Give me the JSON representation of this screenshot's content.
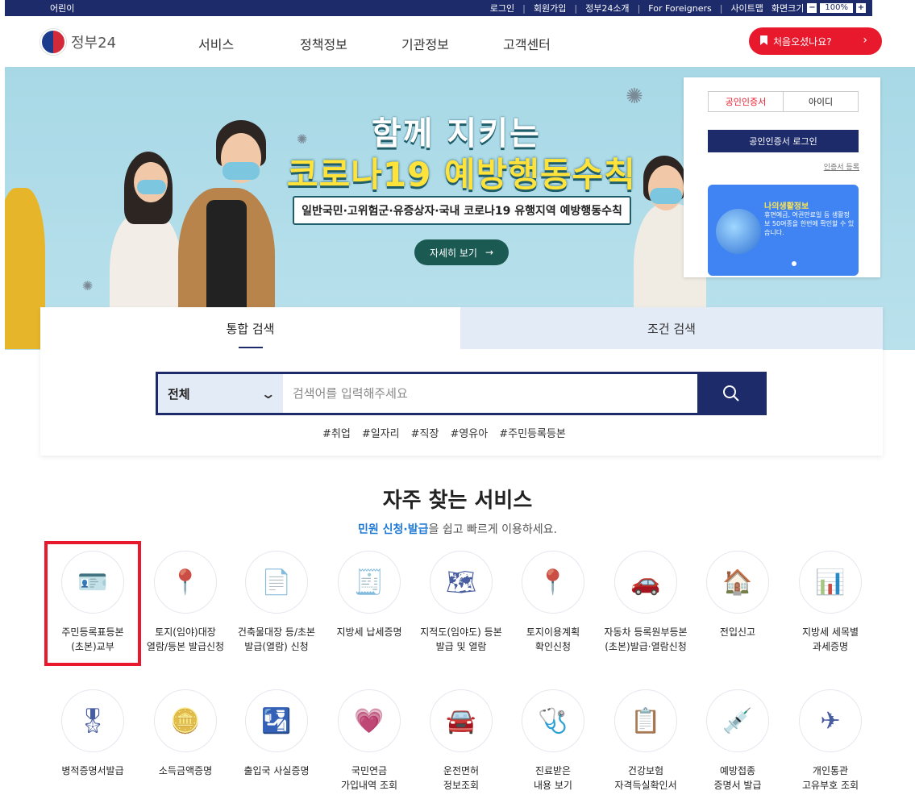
{
  "util": {
    "left": "어린이",
    "links": [
      "로그인",
      "회원가입",
      "정부24소개",
      "For Foreigners",
      "사이트맵"
    ],
    "zoom_label": "화면크기",
    "zoom_value": "100%"
  },
  "header": {
    "logo_text": "정부24",
    "menu": [
      "서비스",
      "정책정보",
      "기관정보",
      "고객센터"
    ],
    "cta": "처음오셨나요?"
  },
  "hero": {
    "title_line1": "함께 지키는",
    "title_line2": "코로나19 예방행동수칙",
    "subtitle": "일반국민·고위험군·유증상자·국내 코로나19 유행지역 예방행동수칙",
    "button": "자세히 보기",
    "colors": {
      "sky": "#b9e1ec",
      "title_fill": "#ffffff",
      "title_yellow": "#ffe33b",
      "button_bg": "#1b5a52"
    }
  },
  "login": {
    "tabs": [
      "공인인증서",
      "아이디"
    ],
    "button": "공인인증서 로그인",
    "register": "인증서 등록",
    "card_title": "나의생활정보",
    "card_desc": "휴면예금, 여권만료일 등 생활정보 50여종을 한번에 확인할 수 있습니다."
  },
  "search": {
    "tabs": [
      "통합 검색",
      "조건 검색"
    ],
    "category": "전체",
    "placeholder": "검색어를 입력해주세요",
    "hashtags": [
      "#취업",
      "#일자리",
      "#직장",
      "#영유아",
      "#주민등록등본"
    ]
  },
  "frequent": {
    "title": "자주 찾는 서비스",
    "sub_highlight": "민원 신청·발급",
    "sub_rest": "을 쉽고 빠르게 이용하세요.",
    "row1": [
      {
        "icon": "resident-card-icon",
        "label1": "주민등록표등본",
        "label2": "(초본)교부"
      },
      {
        "icon": "land-map-pin-icon",
        "label1": "토지(임야)대장",
        "label2": "열람/등본 발급신청"
      },
      {
        "icon": "building-doc-search-icon",
        "label1": "건축물대장 등/초본",
        "label2": "발급(열람) 신청"
      },
      {
        "icon": "tax-doc-icon",
        "label1": "지방세 납세증명",
        "label2": ""
      },
      {
        "icon": "cadastral-map-icon",
        "label1": "지적도(임야도) 등본",
        "label2": "발급 및 열람"
      },
      {
        "icon": "land-use-map-icon",
        "label1": "토지이용계획",
        "label2": "확인신청"
      },
      {
        "icon": "car-registration-icon",
        "label1": "자동차 등록원부등본",
        "label2": "(초본)발급·열람신청"
      },
      {
        "icon": "house-move-icon",
        "label1": "전입신고",
        "label2": ""
      },
      {
        "icon": "tax-chart-icon",
        "label1": "지방세 세목별",
        "label2": "과세증명"
      }
    ],
    "row2": [
      {
        "icon": "military-cert-icon",
        "label1": "병적증명서발급",
        "label2": ""
      },
      {
        "icon": "income-coins-icon",
        "label1": "소득금액증명",
        "label2": ""
      },
      {
        "icon": "passport-icon",
        "label1": "출입국 사실증명",
        "label2": ""
      },
      {
        "icon": "pension-icon",
        "label1": "국민연금",
        "label2": "가입내역 조회"
      },
      {
        "icon": "driver-license-icon",
        "label1": "운전면허",
        "label2": "정보조회"
      },
      {
        "icon": "medical-record-icon",
        "label1": "진료받은",
        "label2": "내용 보기"
      },
      {
        "icon": "health-insurance-icon",
        "label1": "건강보험",
        "label2": "자격득실확인서"
      },
      {
        "icon": "vaccination-icon",
        "label1": "예방접종",
        "label2": "증명서 발급"
      },
      {
        "icon": "customs-code-icon",
        "label1": "개인통관",
        "label2": "고유부호 조회"
      }
    ]
  }
}
